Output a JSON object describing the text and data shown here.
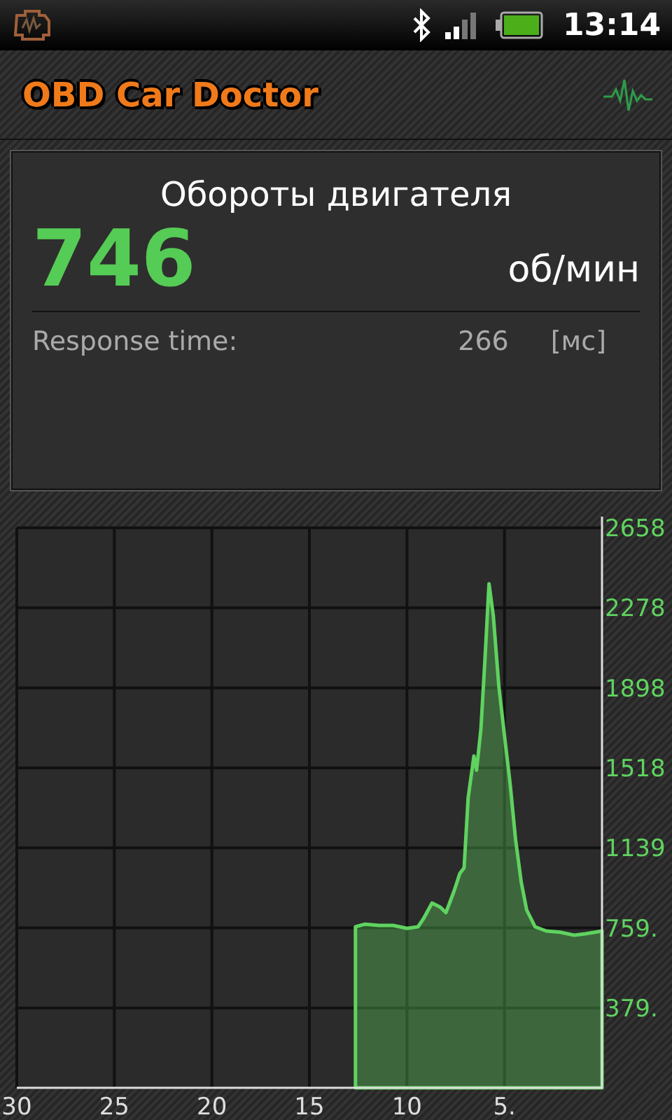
{
  "status_bar": {
    "time": "13:14"
  },
  "app_bar": {
    "title": "OBD Car Doctor"
  },
  "sensor": {
    "name": "Обороты двигателя",
    "value": "746",
    "unit": "об/мин",
    "response_label": "Response time:",
    "response_value": "266",
    "response_unit": "[мс]"
  },
  "chart": {
    "chart_data": {
      "type": "area",
      "x": [
        12.64,
        12.14,
        11.43,
        10.71,
        10.0,
        9.43,
        9.14,
        8.71,
        8.29,
        8.0,
        7.57,
        7.29,
        7.07,
        6.86,
        6.57,
        6.43,
        6.21,
        6.0,
        5.79,
        5.57,
        5.29,
        5.0,
        4.71,
        4.43,
        4.14,
        3.86,
        3.43,
        2.86,
        2.14,
        1.43,
        0.86,
        0.36,
        0
      ],
      "series": [
        {
          "color": "#5fd35f",
          "values": [
            764,
            777,
            771,
            771,
            757,
            764,
            804,
            877,
            857,
            831,
            937,
            1017,
            1044,
            1376,
            1575,
            1508,
            1702,
            2033,
            2392,
            2239,
            1907,
            1674,
            1442,
            1176,
            977,
            844,
            764,
            744,
            738,
            724,
            731,
            738,
            744
          ]
        }
      ],
      "grid": true,
      "xlim": [
        30,
        0
      ],
      "ylim": [
        0,
        2658
      ],
      "xticks": [
        30,
        25,
        20,
        15,
        10,
        {
          "value": 5,
          "label": "5."
        }
      ],
      "yticks": [
        2658,
        2278,
        1898,
        1518,
        1139,
        {
          "value": 759,
          "label": "759."
        },
        {
          "value": 379,
          "label": "379."
        }
      ]
    }
  }
}
